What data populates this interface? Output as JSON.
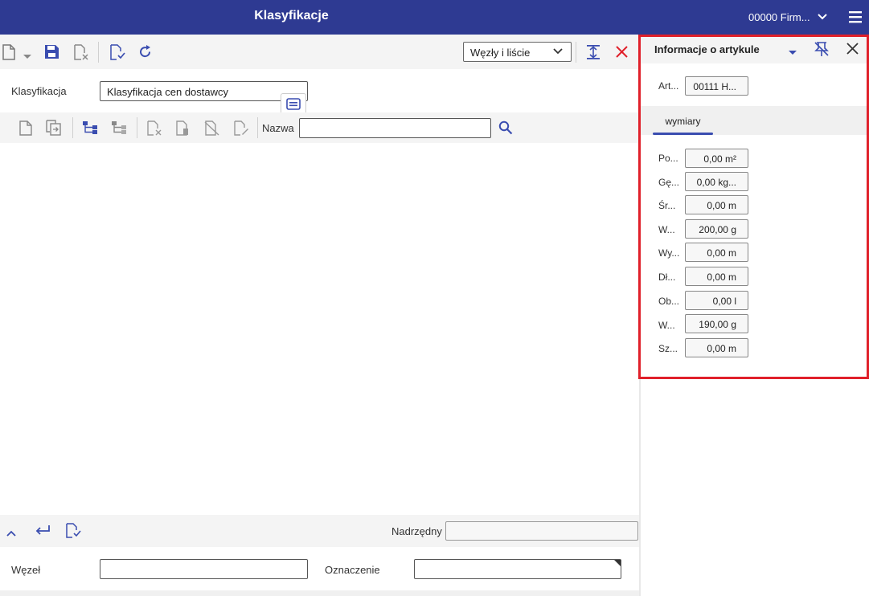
{
  "header": {
    "title": "Klasyfikacje",
    "company": "00000 Firm..."
  },
  "toolbar": {
    "view_select": "Węzły i liście"
  },
  "classification": {
    "label": "Klasyfikacja",
    "value": "Klasyfikacja cen dostawcy"
  },
  "tree_toolbar": {
    "name_label": "Nazwa",
    "name_value": ""
  },
  "bottom": {
    "parent_label": "Nadrzędny",
    "parent_value": "",
    "node_label": "Węzeł",
    "node_value": "",
    "designation_label": "Oznaczenie",
    "designation_value": ""
  },
  "panel": {
    "title": "Informacje o artykule",
    "article_label": "Art...",
    "article_value": "00111 H...",
    "tab": "wymiary",
    "fields": [
      {
        "label": "Po...",
        "value": "0,00 m²"
      },
      {
        "label": "Gę...",
        "value": "0,00 kg..."
      },
      {
        "label": "Śr...",
        "value": "0,00 m"
      },
      {
        "label": "W...",
        "value": "200,00 g"
      },
      {
        "label": "Wy...",
        "value": "0,00 m"
      },
      {
        "label": "Dł...",
        "value": "0,00 m"
      },
      {
        "label": "Ob...",
        "value": "0,00 l"
      },
      {
        "label": "W...",
        "value": "190,00 g"
      },
      {
        "label": "Sz...",
        "value": "0,00 m"
      }
    ]
  },
  "colors": {
    "header_bg": "#2e3a92",
    "accent": "#3a4db0",
    "highlight_frame": "#e0202a",
    "close_red": "#e0202a"
  }
}
